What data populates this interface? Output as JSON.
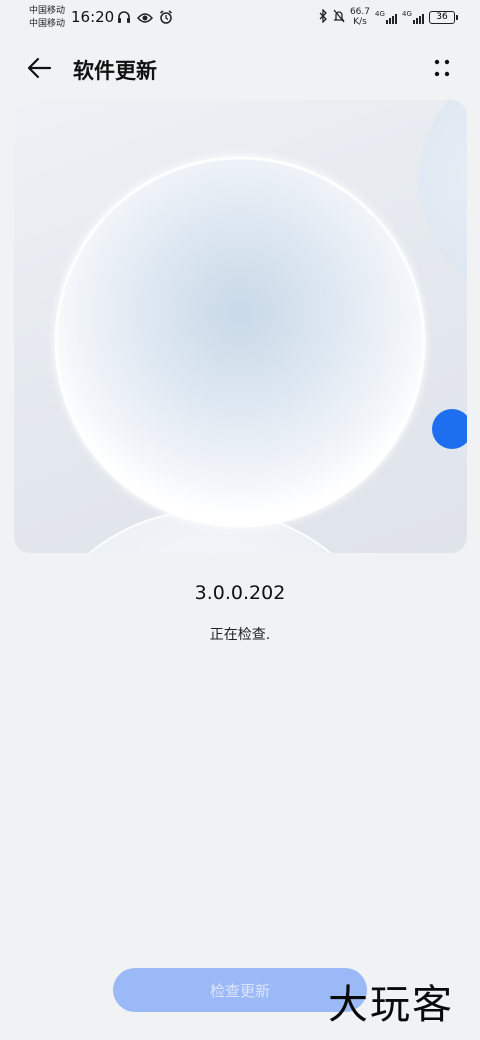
{
  "status_bar": {
    "carrier_1": "中国移动",
    "carrier_2": "中国移动",
    "time": "16:20",
    "net_speed_value": "66.7",
    "net_speed_unit": "K/s",
    "signal_1_type": "4G",
    "signal_2_type": "4G",
    "battery_level": "36",
    "icons": [
      "headphones-icon",
      "eye-icon",
      "alarm-icon",
      "bluetooth-icon",
      "signal-icon",
      "battery-icon"
    ]
  },
  "app_bar": {
    "title": "软件更新",
    "back_icon": "back-arrow-icon",
    "more_icon": "more-options-icon"
  },
  "hero": {
    "accent_color": "#1e6ef0"
  },
  "version": "3.0.0.202",
  "status_text": "正在检查.",
  "check_button_label": "检查更新",
  "watermark": "大玩客"
}
